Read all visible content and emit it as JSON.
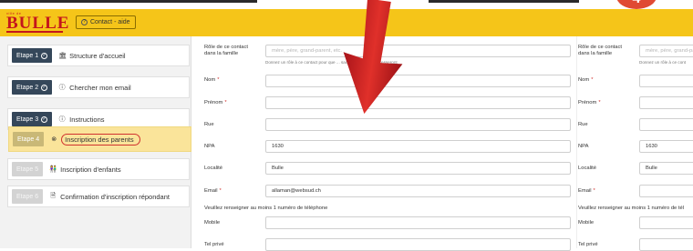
{
  "header": {
    "logo_text": "BULLE",
    "logo_small": "ville de",
    "contact_label": "Contact - aide",
    "contact_icon": "question-circle-icon"
  },
  "steps": [
    {
      "badge": "Etape 1",
      "done": true,
      "icon": "building-icon",
      "label": "Structure d'accueil",
      "state": "done"
    },
    {
      "badge": "Etape 2",
      "done": true,
      "icon": "info-circle-icon",
      "label": "Chercher mon email",
      "state": "done"
    },
    {
      "badge": "Etape 3",
      "done": true,
      "icon": "info-circle-icon",
      "label": "Instructions",
      "state": "done"
    },
    {
      "badge": "Etape 4",
      "done": false,
      "icon": "close-circle-icon",
      "label": "Inscription des parents",
      "state": "active"
    },
    {
      "badge": "Etape 5",
      "done": false,
      "icon": "children-icon",
      "label": "Inscription d'enfants",
      "state": "disabled"
    },
    {
      "badge": "Etape 6",
      "done": false,
      "icon": "document-icon",
      "label": "Confirmation d'inscription répondant",
      "state": "disabled"
    }
  ],
  "form_left": {
    "role_label_1": "Rôle de ce contact",
    "role_label_2": "dans la famille",
    "role_placeholder": "mère, père, grand-parent, etc.",
    "role_help": "Donnez un rôle à ce contact pour que ... sachent à qui ils s'adresseront",
    "nom_label": "Nom",
    "prenom_label": "Prénom",
    "rue_label": "Rue",
    "npa_label": "NPA",
    "npa_value": "1630",
    "localite_label": "Localité",
    "localite_value": "Bulle",
    "email_label": "Email",
    "email_value": "allaman@websud.ch",
    "phone_notice": "Veuillez renseigner au moins 1 numéro de téléphone",
    "mobile_label": "Mobile",
    "telprive_label": "Tel privé"
  },
  "form_right": {
    "role_label_1": "Rôle de ce contact",
    "role_label_2": "dans la famille",
    "role_placeholder": "mère, père, grand-parent",
    "role_help": "Donnez un rôle à ce cont",
    "nom_label": "Nom",
    "prenom_label": "Prénom",
    "rue_label": "Rue",
    "npa_label": "NPA",
    "npa_value": "1630",
    "localite_label": "Localité",
    "localite_value": "Bulle",
    "email_label": "Email",
    "phone_notice": "Veuillez renseigner au moins 1 numéro de tél",
    "mobile_label": "Mobile",
    "telprive_label": "Tel privé"
  },
  "annotation": {
    "number": "4",
    "arrow_color": "#d2231f",
    "highlight_color": "#d0322f"
  },
  "colors": {
    "header_yellow": "#f5c519",
    "step_badge": "#35475a",
    "active_step_bg": "#fae49a"
  }
}
